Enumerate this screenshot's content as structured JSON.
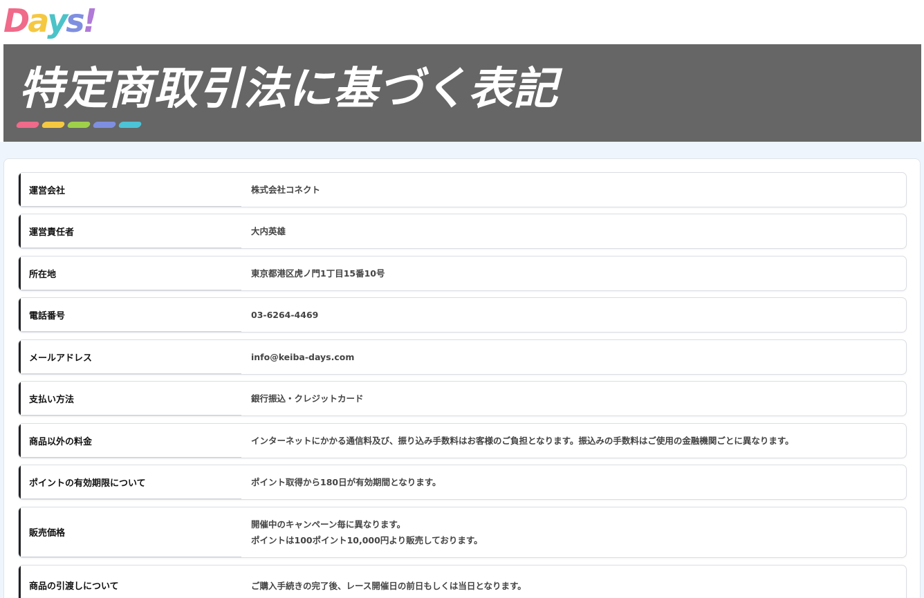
{
  "header": {
    "logo_letters": [
      {
        "char": "D",
        "color": "#f06a8a"
      },
      {
        "char": "a",
        "color": "#f5c842"
      },
      {
        "char": "y",
        "color": "#4cc3c8"
      },
      {
        "char": "s",
        "color": "#7f8fe0"
      },
      {
        "char": "!",
        "color": "#b07ad8"
      }
    ]
  },
  "banner": {
    "title": "特定商取引法に基づく表記",
    "accent_colors": [
      "#f06a8a",
      "#f5c842",
      "#9fd04a",
      "#7f8fe0",
      "#4cc3d6"
    ]
  },
  "rows": [
    {
      "label": "運営会社",
      "values": [
        "株式会社コネクト"
      ]
    },
    {
      "label": "運営責任者",
      "values": [
        "大内英雄"
      ]
    },
    {
      "label": "所在地",
      "values": [
        "東京都港区虎ノ門1丁目15番10号"
      ]
    },
    {
      "label": "電話番号",
      "values": [
        "03-6264-4469"
      ]
    },
    {
      "label": "メールアドレス",
      "values": [
        "info@keiba-days.com"
      ]
    },
    {
      "label": "支払い方法",
      "values": [
        "銀行振込・クレジットカード"
      ]
    },
    {
      "label": "商品以外の料金",
      "values": [
        "インターネットにかかる通信料及び、振り込み手数料はお客様のご負担となります。振込みの手数料はご使用の金融機関ごとに異なります。"
      ]
    },
    {
      "label": "ポイントの有効期限について",
      "values": [
        "ポイント取得から180日が有効期間となります。"
      ]
    },
    {
      "label": "販売価格",
      "values": [
        "開催中のキャンペーン毎に異なります。",
        "ポイントは100ポイント10,000円より販売しております。"
      ]
    },
    {
      "label": "商品の引渡しについて",
      "values": [
        "ご購入手続きの完了後、レース開催日の前日もしくは当日となります。"
      ]
    }
  ]
}
